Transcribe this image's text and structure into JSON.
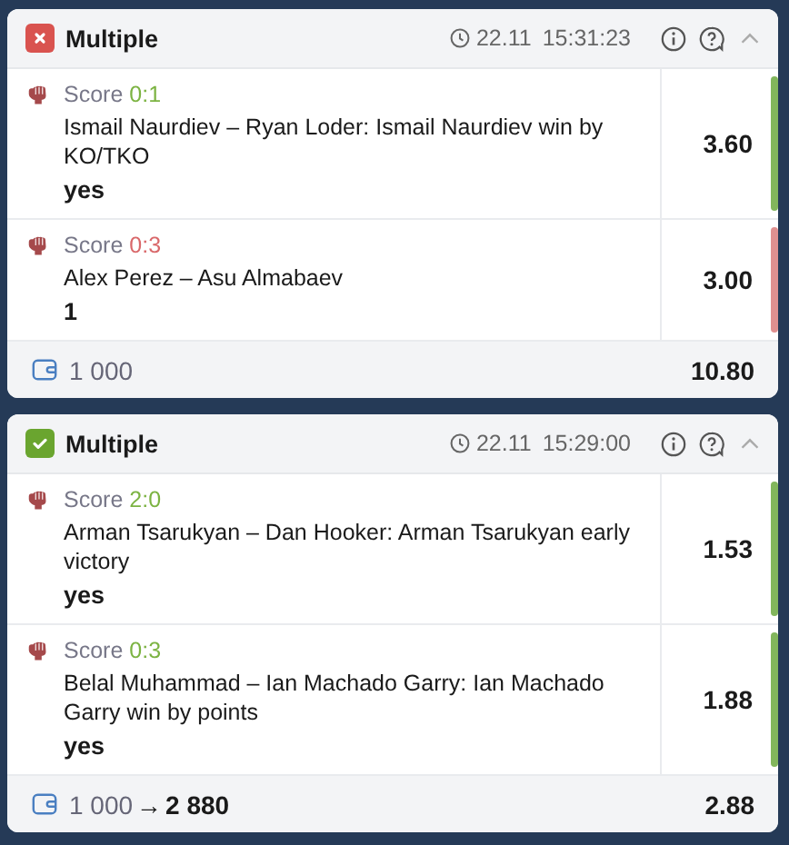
{
  "bets": [
    {
      "won": false,
      "title": "Multiple",
      "date": "22.11",
      "time": "15:31:23",
      "events": [
        {
          "score_label": "Score",
          "score": "0:1",
          "won": true,
          "match": "Ismail Naurdiev – Ryan Loder: Ismail Naurdiev win by KO/TKO",
          "pick": "yes",
          "odds": "3.60"
        },
        {
          "score_label": "Score",
          "score": "0:3",
          "won": false,
          "match": "Alex Perez – Asu Almabaev",
          "pick": "1",
          "odds": "3.00"
        }
      ],
      "stake": "1 000",
      "total_odds": "10.80"
    },
    {
      "won": true,
      "title": "Multiple",
      "date": "22.11",
      "time": "15:29:00",
      "events": [
        {
          "score_label": "Score",
          "score": "2:0",
          "won": true,
          "match": "Arman Tsarukyan – Dan Hooker: Arman Tsarukyan early victory",
          "pick": "yes",
          "odds": "1.53"
        },
        {
          "score_label": "Score",
          "score": "0:3",
          "won": true,
          "match": "Belal Muhammad – Ian Machado Garry: Ian Machado Garry win by points",
          "pick": "yes",
          "odds": "1.88"
        }
      ],
      "stake": "1 000",
      "arrow": "→",
      "payout": "2 880",
      "total_odds": "2.88"
    }
  ]
}
